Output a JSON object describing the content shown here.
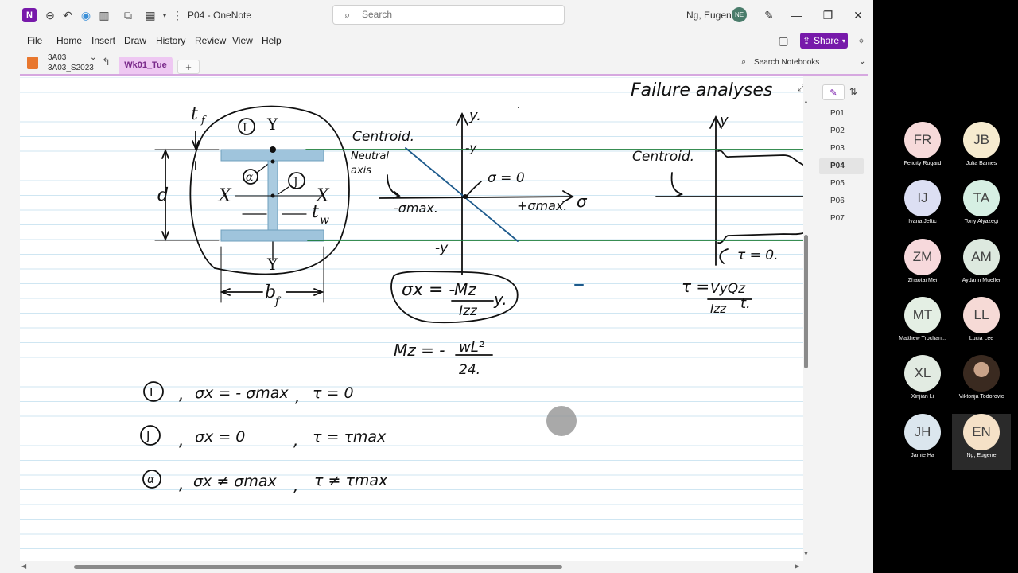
{
  "titlebar": {
    "app_logo": "N",
    "doc_title": "P04  -  OneNote",
    "search_placeholder": "Search",
    "user_name": "Ng, Eugene",
    "user_initials": "NE"
  },
  "menu": [
    "File",
    "Home",
    "Insert",
    "Draw",
    "History",
    "Review",
    "View",
    "Help"
  ],
  "share_label": "Share",
  "notebook": {
    "name": "3A03",
    "section_group": "3A03_S2023",
    "active_tab": "Wk01_Tue",
    "add_tab": "+",
    "search_label": "Search Notebooks"
  },
  "pages": [
    "P01",
    "P02",
    "P03",
    "P04",
    "P05",
    "P06",
    "P07"
  ],
  "active_page": "P04",
  "diagram_labels": {
    "tf": "t",
    "tf_sub": "f",
    "d": "d",
    "y_top": "Y",
    "y_bottom": "Y",
    "x_left": "X",
    "x_right": "X",
    "tw": "t",
    "tw_sub": "w",
    "bf": "b",
    "bf_sub": "f"
  },
  "notes": {
    "title": "Failure analyses",
    "centroid_left": "Centroid.",
    "neutral_axis": "Neutral",
    "neutral_axis2": "axis",
    "sigma_zero": "σ = 0",
    "minus_smax": "-σmax.",
    "plus_smax": "+σmax.",
    "sigma_axis": "σ",
    "y_axis_left": "y.",
    "y_top_left": "-y",
    "y_bottom_left": "-y",
    "formula_lhs": "σx = -",
    "formula_num": "Mz",
    "formula_den": "Izz",
    "formula_y": "y.",
    "moment_lhs": "Mz = -",
    "moment_num": "wL²",
    "moment_den": "24.",
    "centroid_right": "Centroid.",
    "y_axis_right": "y",
    "tau_zero": "τ = 0.",
    "shear_lhs": "τ =",
    "shear_num": "VyQz",
    "shear_den": "Izz",
    "shear_t": "t.",
    "point_i": "I",
    "point_j": "J",
    "point_a": "α",
    "row_i_sigma": "σx = - σmax",
    "row_i_tau": "τ = 0",
    "row_j_sigma": "σx = 0",
    "row_j_tau": "τ = τmax",
    "row_a_sigma": "σx ≠ σmax",
    "row_a_tau": "τ ≠ τmax"
  },
  "participants": [
    {
      "initials": "FR",
      "name": "Felicity Rugard",
      "color": "#f6dada"
    },
    {
      "initials": "JB",
      "name": "Julia Barnes",
      "color": "#f6ebcf"
    },
    {
      "initials": "IJ",
      "name": "Ivana Jeftic",
      "color": "#dcdff3"
    },
    {
      "initials": "TA",
      "name": "Tony Alyazegi",
      "color": "#d6efe3"
    },
    {
      "initials": "ZM",
      "name": "Zhaotai Mei",
      "color": "#f7d9dc"
    },
    {
      "initials": "AM",
      "name": "Aydann Mueller",
      "color": "#dde9df"
    },
    {
      "initials": "MT",
      "name": "Matthew Trochan...",
      "color": "#e4efe4"
    },
    {
      "initials": "LL",
      "name": "Lucia Lee",
      "color": "#f6dad6"
    },
    {
      "initials": "XL",
      "name": "Xinjian Li",
      "color": "#e2ebe2"
    },
    {
      "initials": "",
      "name": "Viktorija Todorovic",
      "color": "photo"
    },
    {
      "initials": "JH",
      "name": "Jamie Ha",
      "color": "#dbe6ee"
    },
    {
      "initials": "EN",
      "name": "Ng, Eugene",
      "color": "#f5e1c7"
    }
  ]
}
